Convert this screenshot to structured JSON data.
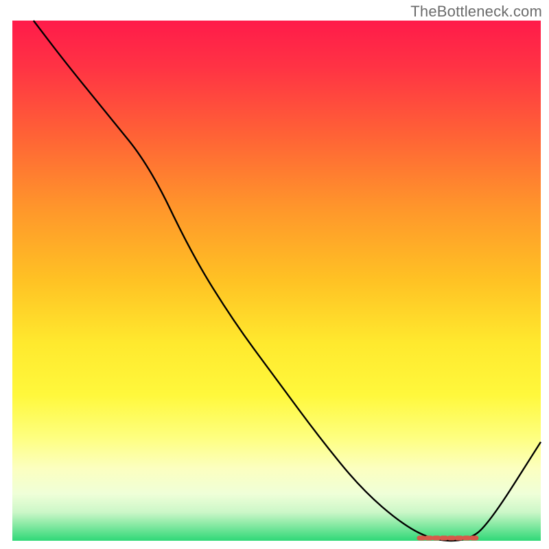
{
  "attribution": {
    "text": "TheBottleneck.com"
  },
  "chart_data": {
    "type": "line",
    "title": "",
    "xlabel": "",
    "ylabel": "",
    "xlim": [
      0,
      100
    ],
    "ylim": [
      0,
      100
    ],
    "grid": false,
    "legend": false,
    "background": {
      "description": "vertical gradient fill across plot area",
      "stops": [
        {
          "pos": 0.0,
          "color": "#ff1b4a"
        },
        {
          "pos": 0.25,
          "color": "#ff6a36"
        },
        {
          "pos": 0.5,
          "color": "#ffc224"
        },
        {
          "pos": 0.72,
          "color": "#fff83c"
        },
        {
          "pos": 0.85,
          "color": "#fdffb8"
        },
        {
          "pos": 0.94,
          "color": "#e0ffd0"
        },
        {
          "pos": 0.975,
          "color": "#86e9a3"
        },
        {
          "pos": 1.0,
          "color": "#2fd877"
        }
      ]
    },
    "series": [
      {
        "name": "bottleneck-curve",
        "color": "#000000",
        "x": [
          4,
          10,
          18,
          26,
          34,
          42,
          50,
          58,
          66,
          74,
          80,
          86,
          90,
          100
        ],
        "y": [
          100,
          92,
          82,
          72,
          55,
          42,
          31,
          20,
          10,
          3,
          0,
          0,
          3,
          19
        ]
      }
    ],
    "annotations": [
      {
        "name": "optimal-range-marker",
        "type": "dashed-segment",
        "color": "#d65a4a",
        "y": 0,
        "x_start": 77,
        "x_end": 88
      }
    ],
    "axes_visible": false
  }
}
